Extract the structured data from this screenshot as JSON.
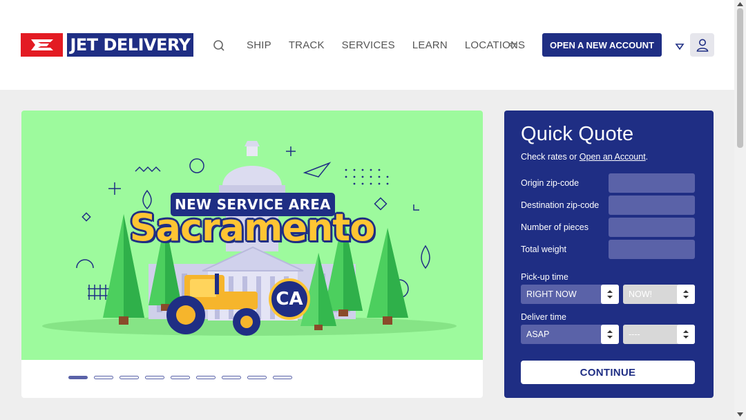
{
  "header": {
    "logo_text": "JET DELIVERY",
    "nav": [
      "SHIP",
      "TRACK",
      "SERVICES",
      "LEARN",
      "LOCATIONS"
    ],
    "open_account_label": "OPEN A NEW ACCOUNT"
  },
  "banner": {
    "tag": "NEW SERVICE AREA",
    "title": "Sacramento",
    "badge": "CA",
    "slide_count": 9,
    "active_slide": 1
  },
  "quote": {
    "title": "Quick Quote",
    "subtitle_prefix": "Check rates or ",
    "subtitle_link": "Open an Account",
    "subtitle_suffix": ".",
    "fields": {
      "origin": "Origin zip-code",
      "destination": "Destination zip-code",
      "pieces": "Number of pieces",
      "weight": "Total weight"
    },
    "pickup_label": "Pick-up time",
    "pickup_select": "RIGHT NOW",
    "pickup_time": "NOW!",
    "deliver_label": "Deliver time",
    "deliver_select": "ASAP",
    "deliver_time": "----",
    "continue_label": "CONTINUE"
  },
  "colors": {
    "brand_navy": "#1f2e84",
    "brand_red": "#e31b23",
    "banner_green": "#9dfa9d",
    "field_bg": "#5a62a8"
  }
}
